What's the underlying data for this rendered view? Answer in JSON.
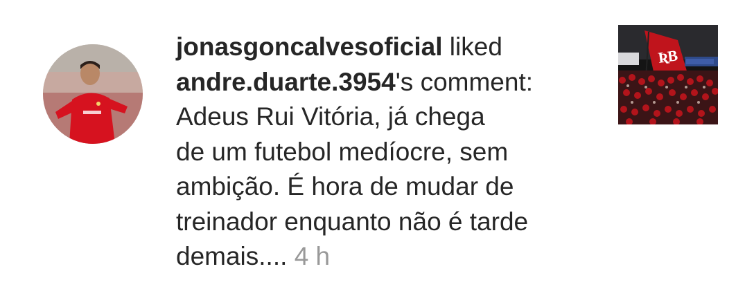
{
  "notification": {
    "username": "jonasgoncalvesoficial",
    "action": " liked",
    "comment_author": "andre.duarte.3954",
    "comment_suffix": "'s comment:",
    "comment_lines": [
      "Adeus Rui Vitória, já chega",
      "de um futebol medíocre, sem",
      "ambição. É hora de mudar de",
      "treinador enquanto não é tarde",
      "demais...."
    ],
    "timestamp": "4 h"
  },
  "avatar": {
    "icon": "profile-photo-footballer",
    "accent": "#d6121f"
  },
  "post_thumbnail": {
    "icon": "stadium-fans-flag-photo",
    "accent": "#c0141c"
  }
}
